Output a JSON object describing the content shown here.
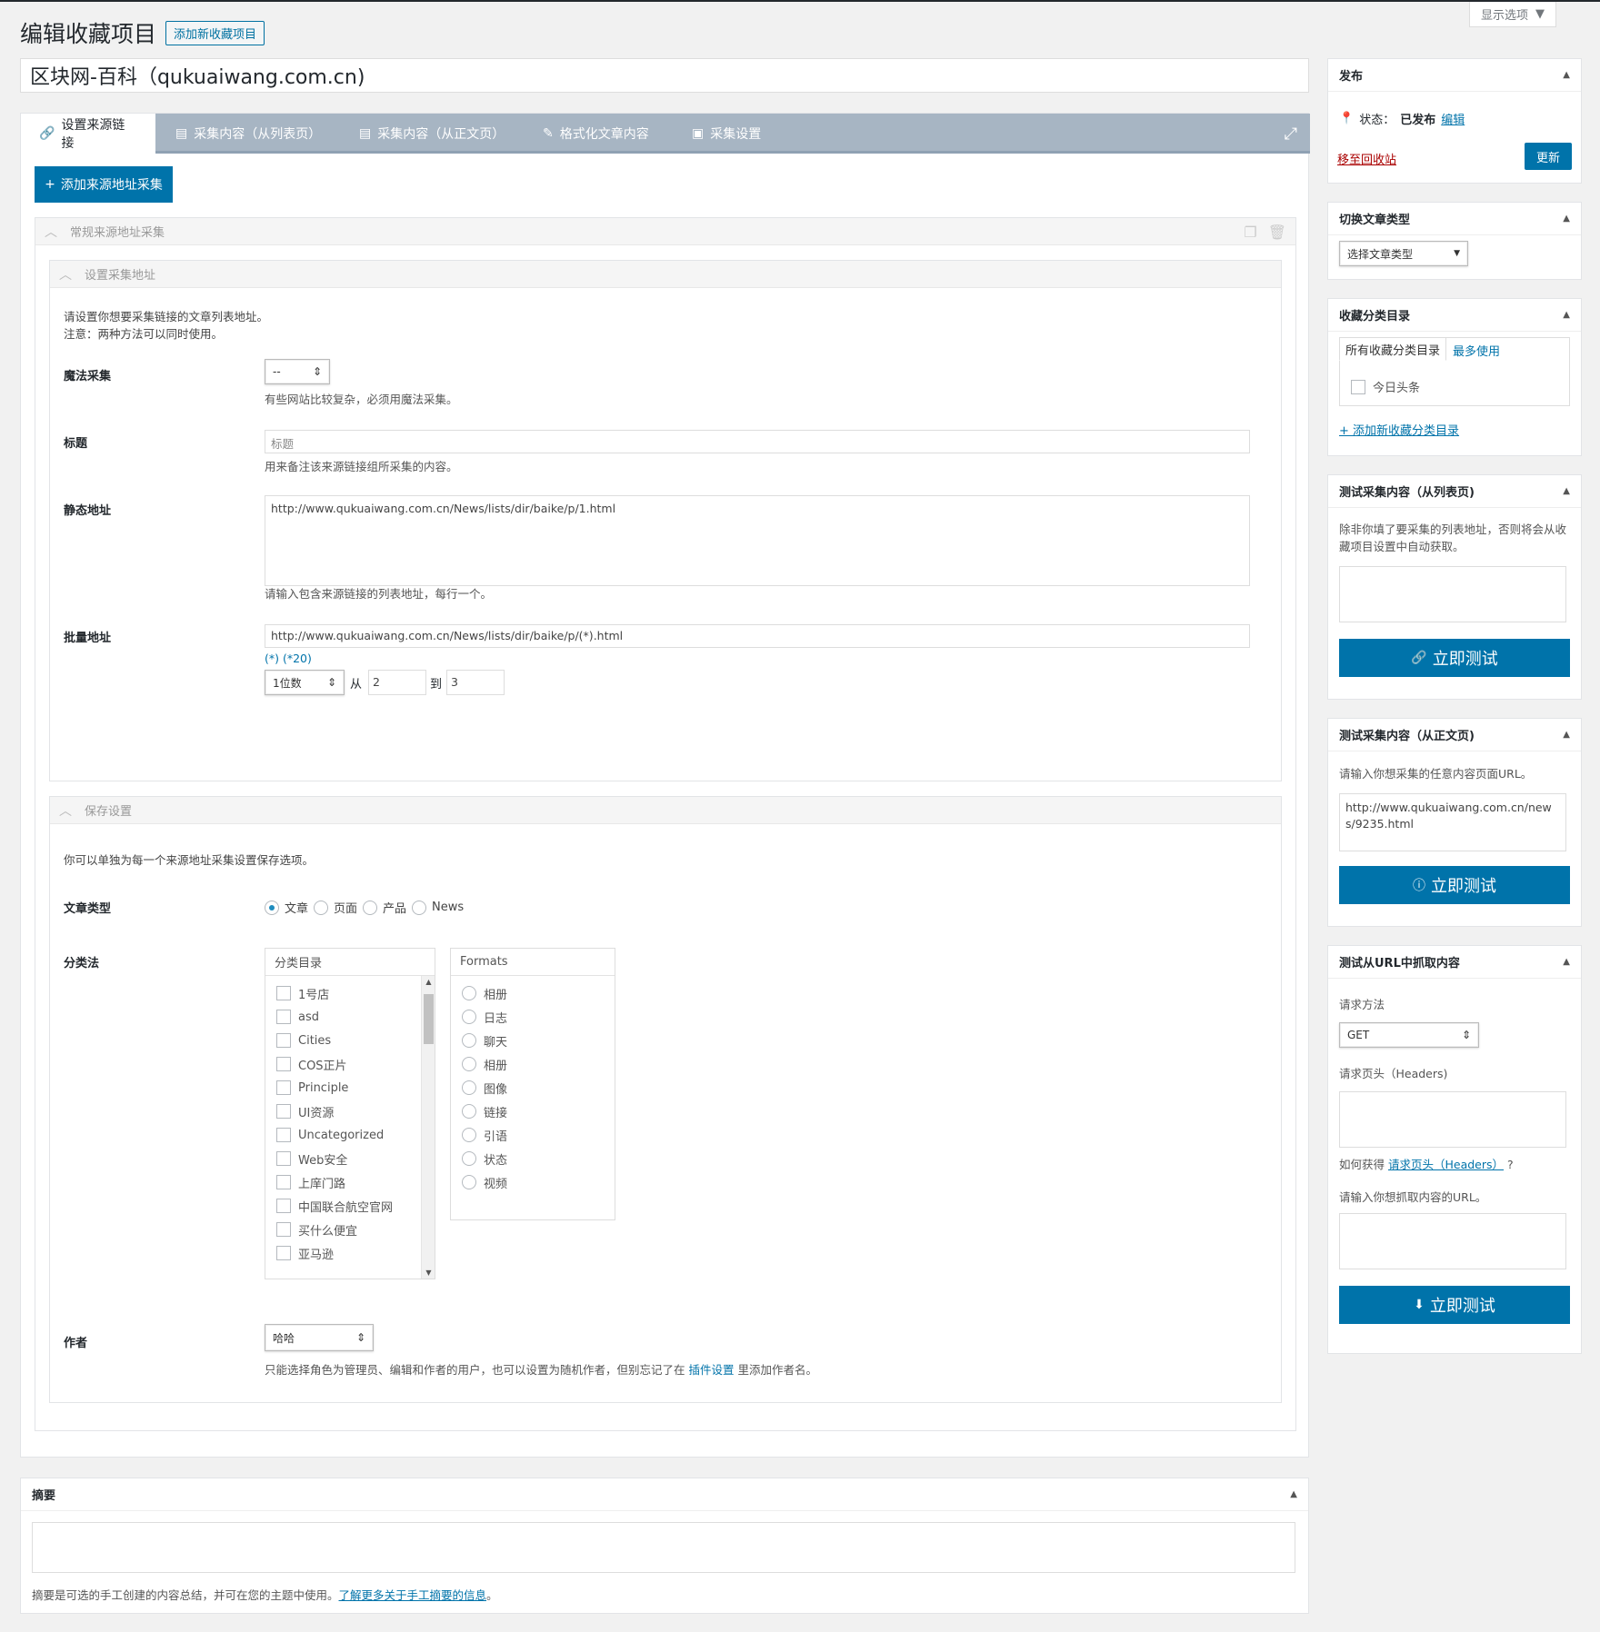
{
  "screen_options": {
    "label": "显示选项"
  },
  "header": {
    "title": "编辑收藏项目",
    "add_new": "添加新收藏项目"
  },
  "post_title": "区块网-百科（qukuaiwang.com.cn)",
  "tabs": [
    {
      "label": "设置来源链接",
      "icon": "link-icon"
    },
    {
      "label": "采集内容（从列表页）",
      "icon": "list-icon"
    },
    {
      "label": "采集内容（从正文页）",
      "icon": "list-icon"
    },
    {
      "label": "格式化文章内容",
      "icon": "edit-icon"
    },
    {
      "label": "采集设置",
      "icon": "settings-icon"
    }
  ],
  "add_source_button": "添加来源地址采集",
  "source_box": {
    "title": "常规来源地址采集",
    "url_box": {
      "title": "设置采集地址",
      "desc_line1": "请设置你想要采集链接的文章列表地址。",
      "desc_line2": "注意：两种方法可以同时使用。",
      "magic": {
        "label": "魔法采集",
        "value": "--",
        "help": "有些网站比较复杂，必须用魔法采集。"
      },
      "title_field": {
        "label": "标题",
        "placeholder": "标题",
        "help": "用来备注该来源链接组所采集的内容。"
      },
      "static": {
        "label": "静态地址",
        "value": "http://www.qukuaiwang.com.cn/News/lists/dir/baike/p/1.html",
        "help": "请输入包含来源链接的列表地址，每行一个。"
      },
      "batch": {
        "label": "批量地址",
        "value": "http://www.qukuaiwang.com.cn/News/lists/dir/baike/p/(*).html",
        "hint": "(*) (*20)",
        "digits": "1位数",
        "from_label": "从",
        "from": "2",
        "to_label": "到",
        "to": "3"
      }
    },
    "save_box": {
      "title": "保存设置",
      "desc": "你可以单独为每一个来源地址采集设置保存选项。",
      "post_type": {
        "label": "文章类型",
        "options": [
          "文章",
          "页面",
          "产品",
          "News"
        ],
        "selected": "文章"
      },
      "taxonomy": {
        "label": "分类法",
        "categories_title": "分类目录",
        "categories": [
          "1号店",
          "asd",
          "Cities",
          "COS正片",
          "Principle",
          "UI资源",
          "Uncategorized",
          "Web安全",
          "上庠门路",
          "中国联合航空官网",
          "买什么便宜",
          "亚马逊"
        ],
        "formats_title": "Formats",
        "formats": [
          "相册",
          "日志",
          "聊天",
          "相册",
          "图像",
          "链接",
          "引语",
          "状态",
          "视频"
        ]
      },
      "author": {
        "label": "作者",
        "value": "哈哈",
        "help_before": "只能选择角色为管理员、编辑和作者的用户，也可以设置为随机作者，但别忘记了在",
        "help_link": "插件设置",
        "help_after": "里添加作者名。"
      }
    }
  },
  "excerpt": {
    "title": "摘要",
    "help_before": "摘要是可选的手工创建的内容总结，并可在您的主题中使用。",
    "help_link": "了解更多关于手工摘要的信息",
    "help_after": "。"
  },
  "publish": {
    "title": "发布",
    "status_label": "状态：",
    "status_value": "已发布",
    "edit": "编辑",
    "trash": "移至回收站",
    "update": "更新"
  },
  "switch_type": {
    "title": "切换文章类型",
    "select": "选择文章类型"
  },
  "collection_cat": {
    "title": "收藏分类目录",
    "tab_all": "所有收藏分类目录",
    "tab_most": "最多使用",
    "item": "今日头条",
    "add_new": "+ 添加新收藏分类目录"
  },
  "test_list": {
    "title": "测试采集内容（从列表页)",
    "desc": "除非你填了要采集的列表地址，否则将会从收藏项目设置中自动获取。",
    "button": "立即测试"
  },
  "test_content": {
    "title": "测试采集内容（从正文页)",
    "desc": "请输入你想采集的任意内容页面URL。",
    "url": "http://www.qukuaiwang.com.cn/news/9235.html",
    "button": "立即测试"
  },
  "test_url": {
    "title": "测试从URL中抓取内容",
    "method_label": "请求方法",
    "method": "GET",
    "headers_label": "请求页头（Headers)",
    "how_before": "如何获得",
    "how_link": "请求页头（Headers）",
    "how_after": "?",
    "url_label": "请输入你想抓取内容的URL。",
    "button": "立即测试"
  },
  "colors": {
    "accent": "#0073aa",
    "tabbar": "#a7b5c3",
    "danger": "#a00"
  }
}
